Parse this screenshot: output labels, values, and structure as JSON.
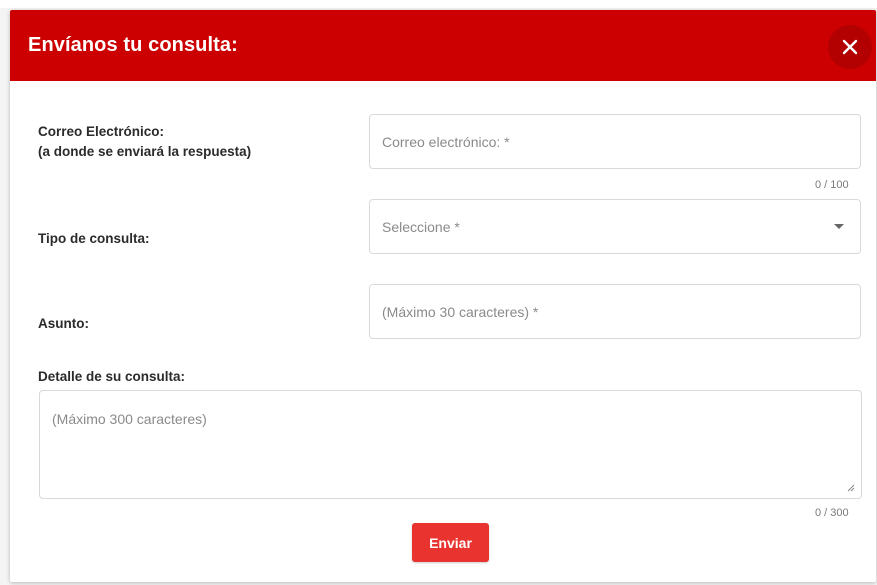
{
  "dialog": {
    "title": "Envíanos tu consulta:",
    "close_icon": "close-icon",
    "header_color": "#cc0000"
  },
  "form": {
    "email": {
      "label_line1": "Correo Electrónico:",
      "label_line2": "(a donde se enviará la respuesta)",
      "placeholder": "Correo electrónico: *",
      "value": "",
      "counter": "0 / 100"
    },
    "type": {
      "label": "Tipo de consulta:",
      "selected": "Seleccione *",
      "icon": "chevron-down-icon"
    },
    "subject": {
      "label": "Asunto:",
      "placeholder": "(Máximo 30 caracteres) *",
      "value": ""
    },
    "detail": {
      "label": "Detalle de su consulta:",
      "placeholder": "(Máximo 300 caracteres)",
      "value": "",
      "counter": "0 / 300"
    },
    "submit_label": "Enviar",
    "submit_color": "#e8332f"
  }
}
